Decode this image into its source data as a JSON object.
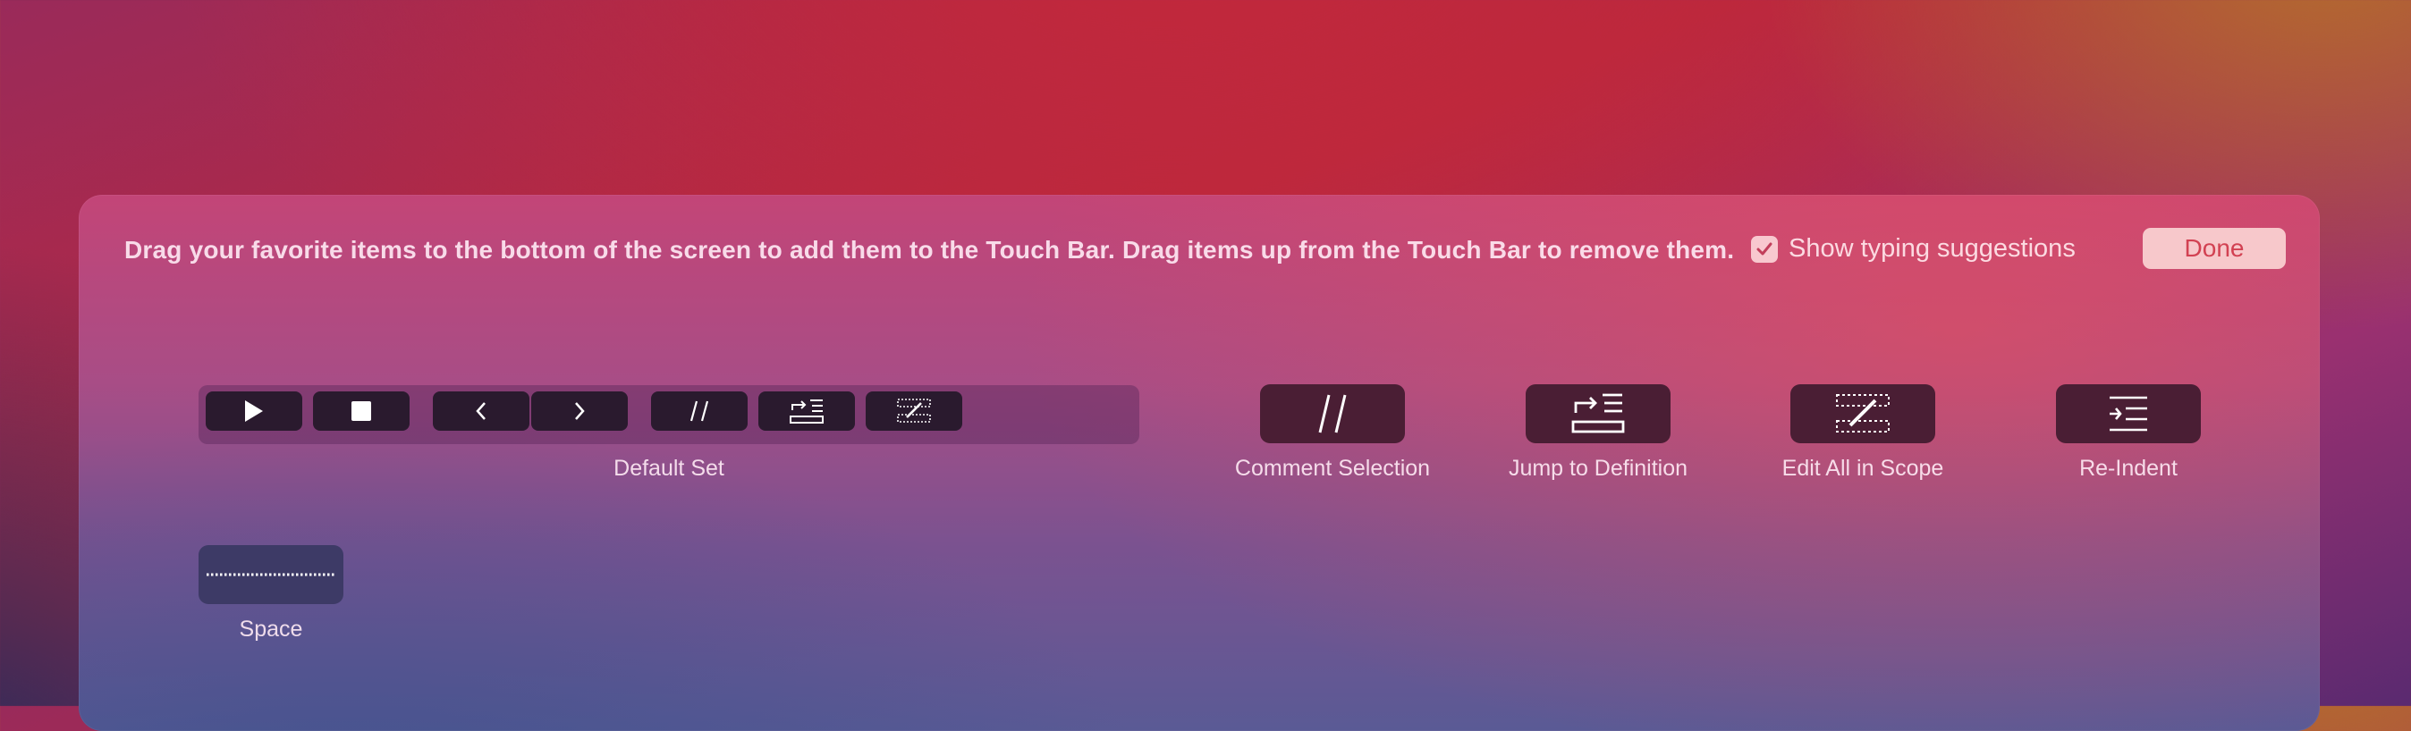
{
  "instructions": "Drag your favorite items to the bottom of the screen to add them to the Touch Bar. Drag items up from the Touch Bar to remove them.",
  "suggestions": {
    "label": "Show typing suggestions",
    "checked": true
  },
  "done_label": "Done",
  "default_set": {
    "label": "Default Set",
    "keys": [
      "play-icon",
      "stop-icon",
      "chevron-left-icon",
      "chevron-right-icon",
      "comment-icon",
      "jump-icon",
      "edit-scope-icon"
    ]
  },
  "items": [
    {
      "label": "Comment Selection",
      "icon": "comment-icon"
    },
    {
      "label": "Jump to Definition",
      "icon": "jump-icon"
    },
    {
      "label": "Edit All in Scope",
      "icon": "edit-scope-icon"
    },
    {
      "label": "Re-Indent",
      "icon": "re-indent-icon"
    }
  ],
  "space_label": "Space",
  "colors": {
    "done_text": "#d24152",
    "done_bg": "#f7c8cb",
    "key_bg": "#4a1e34"
  }
}
